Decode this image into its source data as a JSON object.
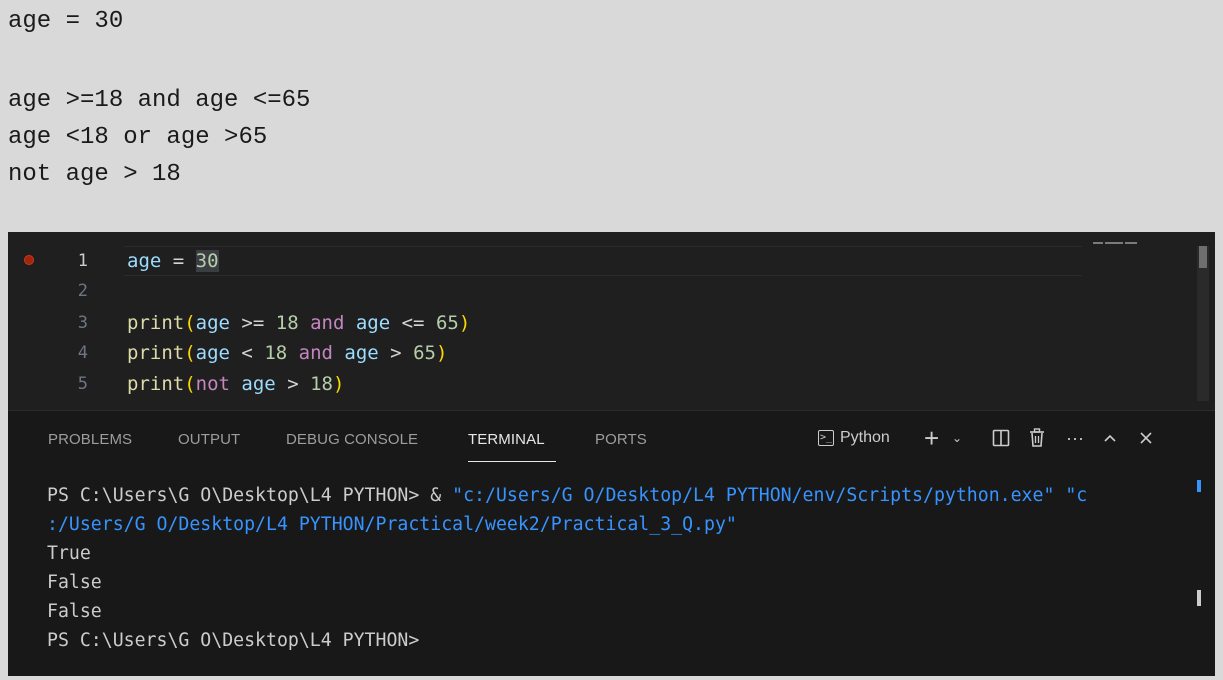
{
  "snippet": {
    "lines": [
      "age = 30",
      "",
      "age >=18 and age <=65",
      "age <18 or age >65",
      "not age > 18"
    ]
  },
  "editor": {
    "line_numbers": [
      "1",
      "2",
      "3",
      "4",
      "5"
    ],
    "active_line": 1,
    "breakpoint_line": 1,
    "line1": {
      "var": "age",
      "op": " = ",
      "num": "30"
    },
    "line3": {
      "fn": "print",
      "open": "(",
      "v1": "age",
      "op1": " >= ",
      "n1": "18",
      "kw": " and ",
      "v2": "age",
      "op2": " <= ",
      "n2": "65",
      "close": ")"
    },
    "line4": {
      "fn": "print",
      "open": "(",
      "v1": "age",
      "op1": " < ",
      "n1": "18",
      "kw": " and ",
      "v2": "age",
      "op2": " > ",
      "n2": "65",
      "close": ")"
    },
    "line5": {
      "fn": "print",
      "open": "(",
      "kw": "not",
      "v1": " age",
      "op1": " > ",
      "n1": "18",
      "close": ")"
    }
  },
  "panel": {
    "tabs": [
      "PROBLEMS",
      "OUTPUT",
      "DEBUG CONSOLE",
      "TERMINAL",
      "PORTS"
    ],
    "active_tab": "TERMINAL",
    "terminal_profile": "Python",
    "icons": [
      "terminal-icon",
      "plus-icon",
      "chevron-down-icon",
      "split-icon",
      "trash-icon",
      "ellipsis-icon",
      "chevron-up-icon",
      "close-icon"
    ]
  },
  "terminal": {
    "prompt1": "PS C:\\Users\\G O\\Desktop\\L4 PYTHON> ",
    "amp": "& ",
    "cmd_part1": "\"c:/Users/G O/Desktop/L4 PYTHON/env/Scripts/python.exe\" \"c",
    "cmd_part2": ":/Users/G O/Desktop/L4 PYTHON/Practical/week2/Practical_3_Q.py\"",
    "output": [
      "True",
      "False",
      "False"
    ],
    "prompt2": "PS C:\\Users\\G O\\Desktop\\L4 PYTHON>"
  },
  "colors": {
    "keyword": "#c586c0",
    "function": "#dcdcaa",
    "number": "#b5cea8",
    "variable": "#9cdcfe",
    "bracket": "#ffd700",
    "terminal_string": "#3794ff"
  }
}
